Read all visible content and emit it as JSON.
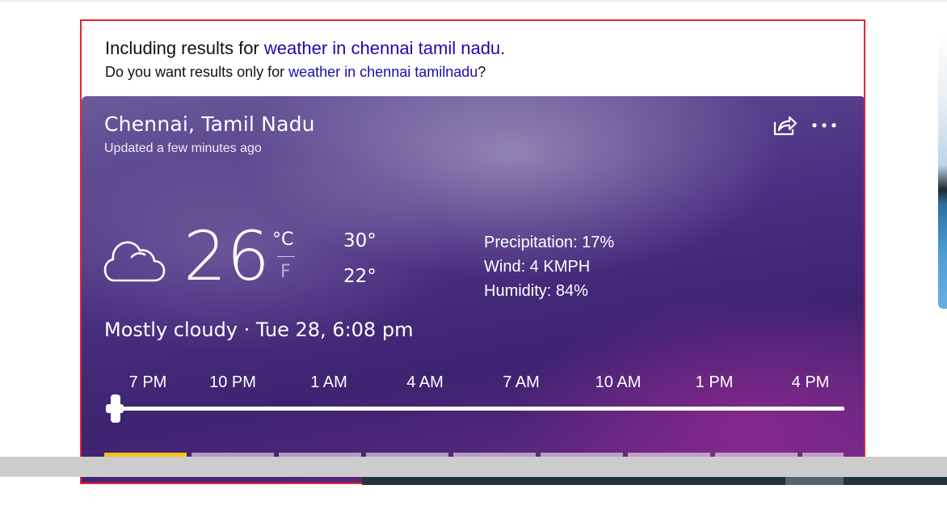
{
  "spell_notice": {
    "including_prefix": "Including results for ",
    "including_query": "weather in chennai tamil nadu",
    "including_suffix": ".",
    "only_prefix": "Do you want results only for ",
    "only_query": "weather in chennai tamilnadu",
    "only_suffix": "?"
  },
  "weather": {
    "location": "Chennai, Tamil Nadu",
    "updated": "Updated a few minutes ago",
    "temperature": "26",
    "unit_c": "°C",
    "unit_f": "F",
    "high": "30°",
    "low": "22°",
    "precipitation": "Precipitation: 17%",
    "wind": "Wind: 4 KMPH",
    "humidity": "Humidity: 84%",
    "condition": "Mostly cloudy · Tue 28, 6:08 pm",
    "condition_icon": "cloud-icon",
    "timeline": [
      "7 PM",
      "10 PM",
      "1 AM",
      "4 AM",
      "7 AM",
      "10 AM",
      "1 PM",
      "4 PM"
    ],
    "day_tab_count": 9,
    "active_day_tab": 0,
    "slider_position": 0
  },
  "colors": {
    "link": "#1a0dab",
    "highlight_border": "#e3262c",
    "active_day_tab": "#f5c31b"
  }
}
